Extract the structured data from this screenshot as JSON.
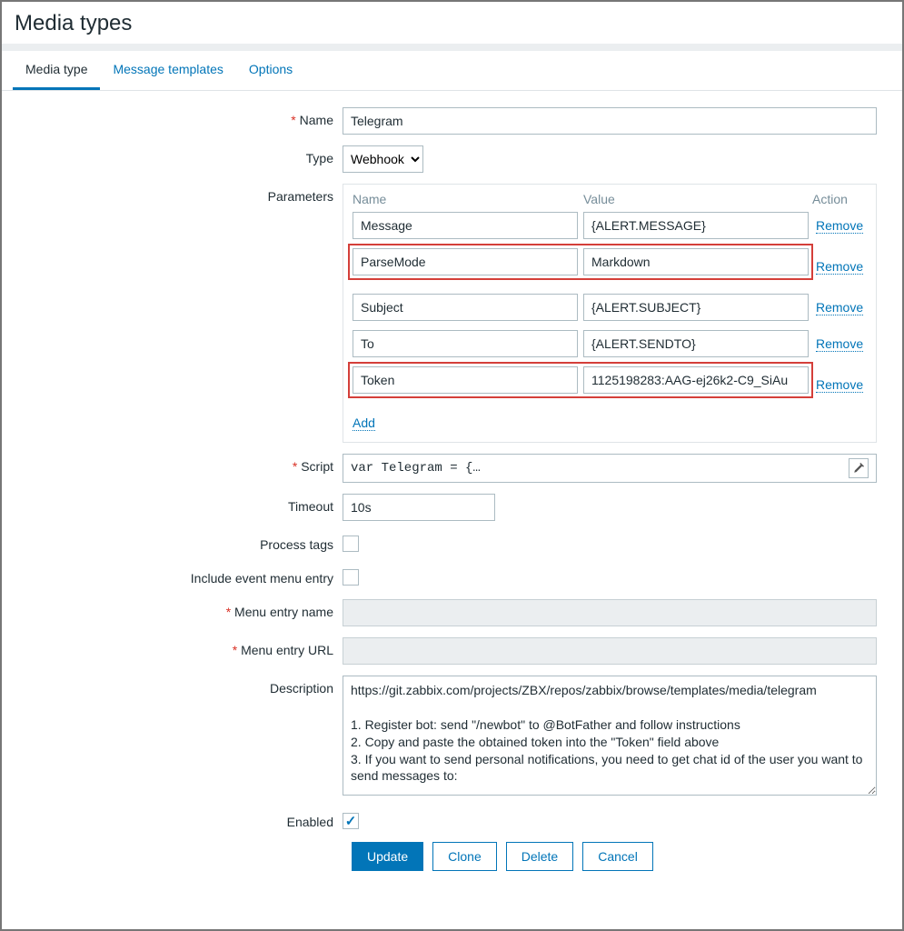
{
  "page_title": "Media types",
  "tabs": [
    "Media type",
    "Message templates",
    "Options"
  ],
  "active_tab": 0,
  "labels": {
    "name": "Name",
    "type": "Type",
    "parameters": "Parameters",
    "script": "Script",
    "timeout": "Timeout",
    "process_tags": "Process tags",
    "include_event_menu": "Include event menu entry",
    "menu_entry_name": "Menu entry name",
    "menu_entry_url": "Menu entry URL",
    "description": "Description",
    "enabled": "Enabled"
  },
  "fields": {
    "name": "Telegram",
    "type_selected": "Webhook",
    "type_options": [
      "Webhook"
    ],
    "script": "var Telegram = {…",
    "timeout": "10s",
    "process_tags": false,
    "include_event_menu": false,
    "menu_entry_name": "",
    "menu_entry_url": "",
    "description": "https://git.zabbix.com/projects/ZBX/repos/zabbix/browse/templates/media/telegram\n\n1. Register bot: send \"/newbot\" to @BotFather and follow instructions\n2. Copy and paste the obtained token into the \"Token\" field above\n3. If you want to send personal notifications, you need to get chat id of the user you want to send messages to:",
    "enabled": true
  },
  "params_header": {
    "name": "Name",
    "value": "Value",
    "action": "Action"
  },
  "params": [
    {
      "name": "Message",
      "value": "{ALERT.MESSAGE}",
      "highlight": false
    },
    {
      "name": "ParseMode",
      "value": "Markdown",
      "highlight": true
    },
    {
      "name": "Subject",
      "value": "{ALERT.SUBJECT}",
      "highlight": false
    },
    {
      "name": "To",
      "value": "{ALERT.SENDTO}",
      "highlight": false
    },
    {
      "name": "Token",
      "value": "1125198283:AAG-ej26k2-C9_SiAu",
      "highlight": true
    }
  ],
  "actions": {
    "remove": "Remove",
    "add": "Add"
  },
  "buttons": {
    "update": "Update",
    "clone": "Clone",
    "delete": "Delete",
    "cancel": "Cancel"
  }
}
